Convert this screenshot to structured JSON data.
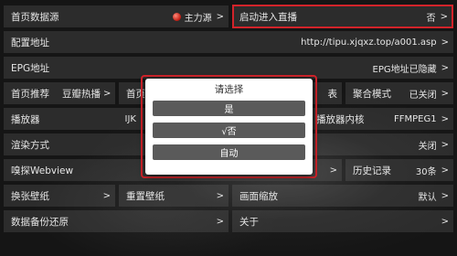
{
  "rows": [
    {
      "label": "首页数据源",
      "value": "主力源",
      "has_dot": true
    },
    {
      "label": "启动进入直播",
      "value": "否"
    },
    {
      "label": "配置地址",
      "value": "http://tipu.xjqxz.top/a001.asp"
    },
    {
      "label": "EPG地址",
      "value": "EPG地址已隐藏"
    },
    {
      "label": "首页推荐",
      "value": "豆瓣热播"
    },
    {
      "label": "首页"
    },
    {
      "label": "表"
    },
    {
      "label": "聚合模式",
      "value": "已关闭"
    },
    {
      "label": "播放器",
      "value": "IJK"
    },
    {
      "label": "播放器内核",
      "value": "FFMPEG1"
    },
    {
      "label": "渲染方式",
      "value": "关闭"
    },
    {
      "label": "嗅探Webview"
    },
    {
      "label": "历史记录",
      "value": "30条"
    },
    {
      "label": "换张壁纸"
    },
    {
      "label": "重置壁纸"
    },
    {
      "label": "画面缩放",
      "value": "默认"
    },
    {
      "label": "数据备份还原"
    },
    {
      "label": "关于"
    }
  ],
  "chevron": ">",
  "dialog": {
    "title": "请选择",
    "options": [
      "是",
      "√否",
      "自动"
    ]
  }
}
